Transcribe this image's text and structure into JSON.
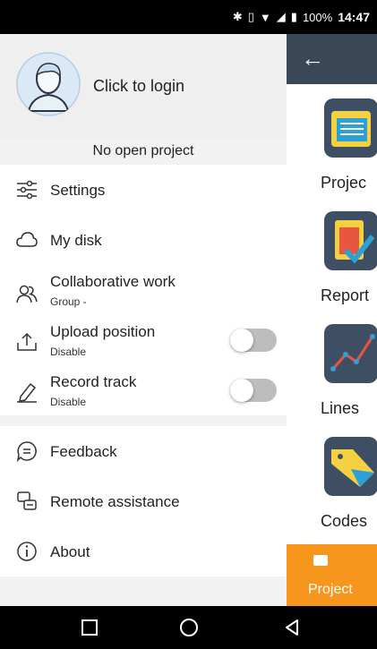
{
  "status_bar": {
    "icons": [
      "bluetooth-icon",
      "vibrate-icon",
      "wifi-icon",
      "signal-icon",
      "battery-icon"
    ],
    "battery": "100%",
    "time": "14:47"
  },
  "drawer": {
    "login_label": "Click to login",
    "project_status": "No open project",
    "items": [
      {
        "label": "Settings",
        "icon": "settings-sliders-icon"
      },
      {
        "label": "My disk",
        "icon": "cloud-icon"
      },
      {
        "label": "Collaborative work",
        "sub": "Group -",
        "icon": "people-icon"
      },
      {
        "label": "Upload position",
        "sub": "Disable",
        "icon": "upload-icon",
        "toggle": false
      },
      {
        "label": "Record track",
        "sub": "Disable",
        "icon": "pen-icon",
        "toggle": false
      },
      {
        "label": "Feedback",
        "icon": "chat-icon"
      },
      {
        "label": "Remote assistance",
        "icon": "remote-icon"
      },
      {
        "label": "About",
        "icon": "info-icon"
      }
    ]
  },
  "background_app": {
    "tiles": [
      "Projec",
      "Report",
      "Lines",
      "Codes"
    ],
    "bottom_tab": "Project"
  },
  "colors": {
    "accent": "#f6961c",
    "toolbar": "#3a4756",
    "tile": "#3e4f63",
    "toggle_off": "#bdbdbd"
  }
}
